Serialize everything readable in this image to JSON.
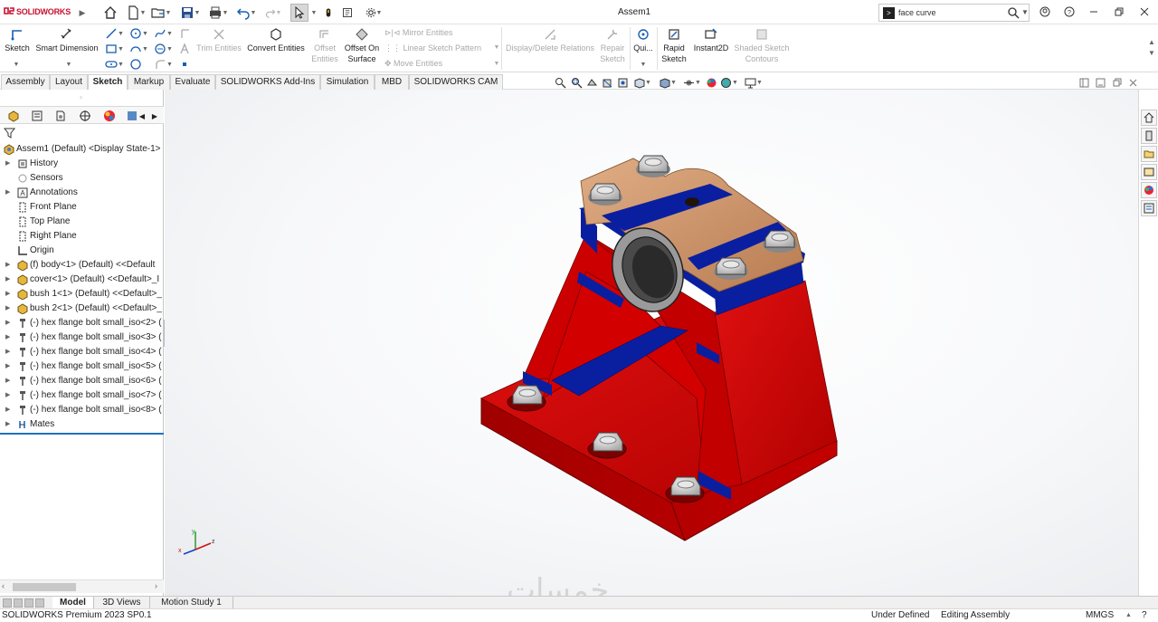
{
  "app": {
    "logo_text": "SOLIDWORKS",
    "document_title": "Assem1",
    "search_value": "face curve"
  },
  "ribbon": {
    "sketch": "Sketch",
    "smart_dimension": "Smart Dimension",
    "trim_entities": "Trim Entities",
    "convert_entities": "Convert Entities",
    "offset_entities_1": "Offset",
    "offset_entities_2": "Entities",
    "offset_surface_1": "Offset On",
    "offset_surface_2": "Surface",
    "mirror_entities": "Mirror Entities",
    "linear_pattern": "Linear Sketch Pattern",
    "move_entities": "Move Entities",
    "display_relations": "Display/Delete Relations",
    "repair_sketch_1": "Repair",
    "repair_sketch_2": "Sketch",
    "quick_snaps": "Qui...",
    "rapid_sketch_1": "Rapid",
    "rapid_sketch_2": "Sketch",
    "instant2d": "Instant2D",
    "shaded_contours_1": "Shaded Sketch",
    "shaded_contours_2": "Contours"
  },
  "tabs": [
    "Assembly",
    "Layout",
    "Sketch",
    "Markup",
    "Evaluate",
    "SOLIDWORKS Add-Ins",
    "Simulation",
    "MBD",
    "SOLIDWORKS CAM"
  ],
  "tree": {
    "root": "Assem1 (Default) <Display State-1>",
    "items": [
      {
        "label": "History",
        "icon": "history-icon",
        "expand": true
      },
      {
        "label": "Sensors",
        "icon": "sensors-icon",
        "expand": false
      },
      {
        "label": "Annotations",
        "icon": "annotations-icon",
        "expand": true
      },
      {
        "label": "Front Plane",
        "icon": "plane-icon",
        "expand": false
      },
      {
        "label": "Top Plane",
        "icon": "plane-icon",
        "expand": false
      },
      {
        "label": "Right Plane",
        "icon": "plane-icon",
        "expand": false
      },
      {
        "label": "Origin",
        "icon": "origin-icon",
        "expand": false
      },
      {
        "label": "(f) body<1> (Default) <<Default",
        "icon": "part-icon",
        "expand": true
      },
      {
        "label": "cover<1> (Default) <<Default>_I",
        "icon": "part-icon",
        "expand": true
      },
      {
        "label": "bush 1<1> (Default) <<Default>_",
        "icon": "part-icon",
        "expand": true
      },
      {
        "label": "bush 2<1> (Default) <<Default>_",
        "icon": "part-icon",
        "expand": true
      },
      {
        "label": "(-) hex flange bolt small_iso<2> (",
        "icon": "bolt-icon",
        "expand": true
      },
      {
        "label": "(-) hex flange bolt small_iso<3> (",
        "icon": "bolt-icon",
        "expand": true
      },
      {
        "label": "(-) hex flange bolt small_iso<4> (",
        "icon": "bolt-icon",
        "expand": true
      },
      {
        "label": "(-) hex flange bolt small_iso<5> (",
        "icon": "bolt-icon",
        "expand": true
      },
      {
        "label": "(-) hex flange bolt small_iso<6> (",
        "icon": "bolt-icon",
        "expand": true
      },
      {
        "label": "(-) hex flange bolt small_iso<7> (",
        "icon": "bolt-icon",
        "expand": true
      },
      {
        "label": "(-) hex flange bolt small_iso<8> (",
        "icon": "bolt-icon",
        "expand": true
      },
      {
        "label": "Mates",
        "icon": "mates-icon",
        "expand": true
      }
    ]
  },
  "bottom_tabs": [
    "Model",
    "3D Views",
    "Motion Study 1"
  ],
  "status": {
    "product": "SOLIDWORKS Premium 2023 SP0.1",
    "defined": "Under Defined",
    "mode": "Editing Assembly",
    "units": "MMGS"
  },
  "triad": {
    "x": "x",
    "y": "y",
    "z": "z"
  },
  "colors": {
    "body": "#cc0000",
    "bush": "#0a1fa0",
    "cover": "#c98e62",
    "bolt": "#d0d0d0"
  }
}
